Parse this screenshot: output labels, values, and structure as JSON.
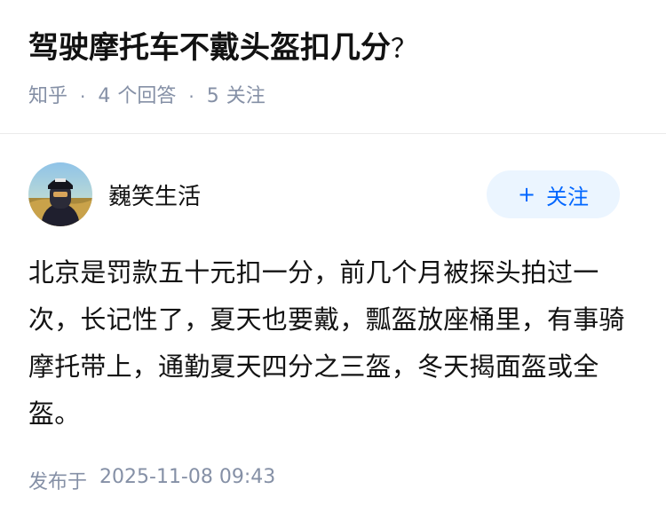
{
  "question": {
    "title": "驾驶摩托车不戴头盔扣几分",
    "title_suffix": "？",
    "source": "知乎",
    "separator": "·",
    "answers_count": "4",
    "answers_label": "个回答",
    "followers_count": "5",
    "followers_label": "关注"
  },
  "answer": {
    "author_name": "巍笑生活",
    "follow_plus": "+",
    "follow_label": "关注",
    "content": "北京是罚款五十元扣一分，前几个月被探头拍过一次，长记性了，夏天也要戴，瓢盔放座桶里，有事骑摩托带上，通勤夏天四分之三盔，冬天揭面盔或全盔。",
    "published_label": "发布于",
    "published_time": "2025-11-08 09:43"
  },
  "colors": {
    "accent": "#0066ff",
    "follow_bg": "#ebf5ff",
    "meta_text": "#8590a6",
    "title_text": "#121212"
  },
  "icons": {
    "avatar": "avatar-image"
  }
}
